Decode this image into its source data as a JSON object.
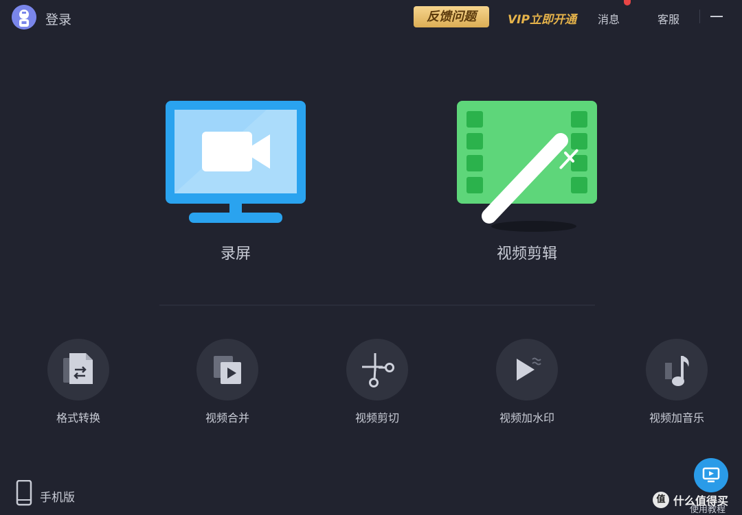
{
  "titlebar": {
    "login_label": "登录",
    "feedback_label": "反馈问题",
    "vip_label": "VIP立即开通",
    "message_label": "消息",
    "service_label": "客服"
  },
  "main_features": [
    {
      "label": "录屏",
      "icon": "screen-record-icon",
      "color": "#2aa3ef"
    },
    {
      "label": "视频剪辑",
      "icon": "video-edit-icon",
      "color": "#5ed67a"
    }
  ],
  "tools": [
    {
      "label": "格式转换",
      "icon": "format-convert-icon"
    },
    {
      "label": "视频合并",
      "icon": "video-merge-icon"
    },
    {
      "label": "视频剪切",
      "icon": "scissors-icon"
    },
    {
      "label": "视频加水印",
      "icon": "watermark-icon"
    },
    {
      "label": "视频加音乐",
      "icon": "music-note-icon"
    }
  ],
  "footer": {
    "mobile_label": "手机版",
    "tutorial_label": "使用教程"
  },
  "watermark": {
    "circle_text": "值",
    "text": "什么值得买"
  },
  "colors": {
    "background": "#21232f",
    "text": "#c9ccd6",
    "feedback_gold": "#e6b34a",
    "record_blue": "#2aa3ef",
    "edit_green": "#5ed67a",
    "tutorial_blue": "#2a9be8",
    "notification_red": "#e84545"
  }
}
